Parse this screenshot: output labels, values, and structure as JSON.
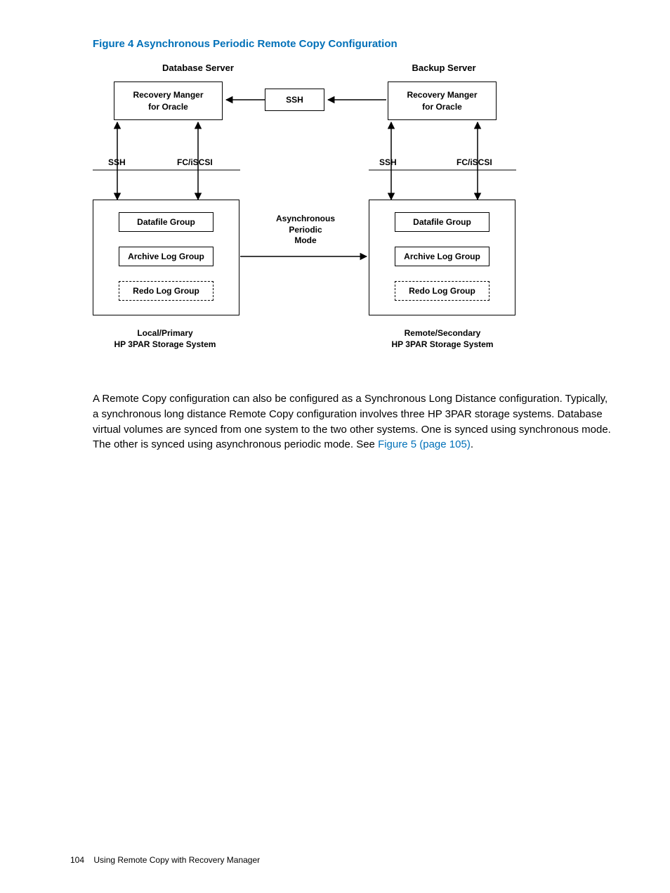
{
  "figure": {
    "title": "Figure 4 Asynchronous Periodic Remote Copy Configuration",
    "headers": {
      "db": "Database Server",
      "backup": "Backup Server"
    },
    "boxes": {
      "rm_left": "Recovery Manger\nfor Oracle",
      "rm_right": "Recovery Manger\nfor Oracle",
      "ssh_box": "SSH",
      "datafile": "Datafile Group",
      "archive": "Archive Log Group",
      "redo": "Redo Log Group"
    },
    "labels": {
      "ssh_left": "SSH",
      "fciscsi_left": "FC/iSCSI",
      "ssh_right": "SSH",
      "fciscsi_right": "FC/iSCSI",
      "mode": "Asynchronous\nPeriodic\nMode",
      "local": "Local/Primary\nHP 3PAR Storage System",
      "remote": "Remote/Secondary\nHP 3PAR Storage System"
    }
  },
  "paragraph": {
    "text": "A Remote Copy configuration can also be configured as a Synchronous Long Distance configuration. Typically, a synchronous long distance Remote Copy configuration involves three HP 3PAR storage systems. Database virtual volumes are synced from one system to the two other systems. One is synced using synchronous mode. The other is synced using asynchronous periodic mode. See ",
    "link": "Figure 5 (page 105)",
    "after": "."
  },
  "footer": {
    "page": "104",
    "title": "Using Remote Copy with Recovery Manager"
  }
}
